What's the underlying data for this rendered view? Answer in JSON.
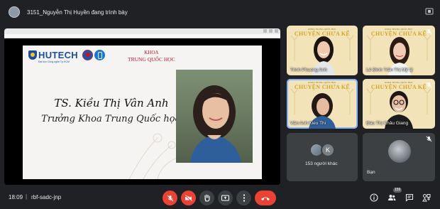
{
  "topbar": {
    "presenter_text": "3151_Nguyễn Thị Huyền đang trình bày"
  },
  "slide": {
    "window_title": "",
    "hutech_logo": "HUTECH",
    "hutech_sub": "Đại học Công nghệ Tp.HCM",
    "khoa_line1": "KHOA",
    "khoa_line2": "TRUNG QUỐC HỌC",
    "name": "TS. Kiều Thị Vân Anh",
    "role": "Trưởng Khoa Trung Quốc học"
  },
  "tiles": [
    {
      "name": "Trinh Phuong Anh",
      "banner": "CHUYỆN CHƯA KỂ",
      "banner_top": "KHOA TRUNG QUỐC HỌC"
    },
    {
      "name": "Lê Đình Trần Thị Mỹ Q",
      "banner": "CHUYỆN CHƯA KỂ",
      "banner_top": "KHOA TRUNG QUỐC HỌC"
    },
    {
      "name": "Vân Anh Kieu Thi",
      "banner": "CHUYỆN CHƯA KỂ",
      "banner_top": "KHOA TRUNG QUỐC HỌC"
    },
    {
      "name": "Đào Thị Châu Giang",
      "banner": "CHUYỆN CHƯA KỂ",
      "banner_top": "KHOA TRUNG QUỐC HỌC"
    }
  ],
  "others": {
    "initial": "K",
    "label": "153 người khác"
  },
  "self": {
    "label": "Bạn"
  },
  "bottombar": {
    "time": "18:09",
    "separator": "|",
    "meeting_code": "rbf-sadc-jnp",
    "participants_badge": "159"
  },
  "colors": {
    "background": "#202124",
    "danger": "#ea4335",
    "control_grey": "#3c4043",
    "accent": "#8ab4f8"
  },
  "icons": {
    "mic_off": "mic-off-icon",
    "cam_off": "camera-off-icon",
    "hand": "raise-hand-icon",
    "present": "present-icon",
    "more": "more-icon",
    "end": "end-call-icon",
    "info": "info-icon",
    "people": "people-icon",
    "chat": "chat-icon",
    "activities": "activities-icon"
  }
}
